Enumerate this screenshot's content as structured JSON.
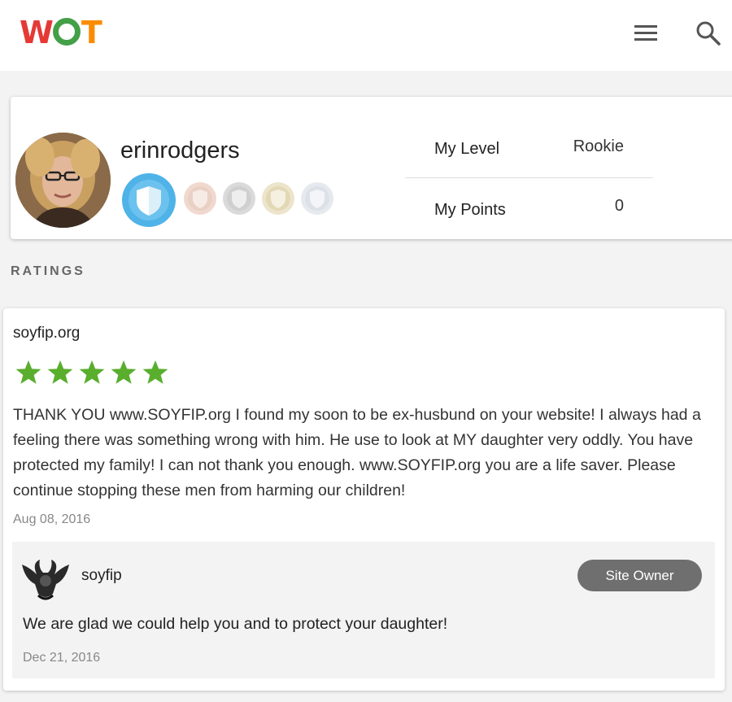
{
  "header": {
    "logo_text": "WOT",
    "menu_icon": "hamburger-menu-icon",
    "search_icon": "search-icon"
  },
  "profile": {
    "username": "erinrodgers",
    "avatar_icon": "user-photo-avatar",
    "badges": [
      {
        "name": "blue-shield-badge",
        "color": "#4fb3e8",
        "active": true
      },
      {
        "name": "rose-shield-badge",
        "color": "#e8c9bd",
        "active": false
      },
      {
        "name": "grey-shield-badge",
        "color": "#d0d0d0",
        "active": false
      },
      {
        "name": "gold-shield-badge",
        "color": "#e6dcbf",
        "active": false
      },
      {
        "name": "silver-shield-badge",
        "color": "#dde2e8",
        "active": false
      }
    ],
    "level_label": "My Level",
    "level_value": "Rookie",
    "points_label": "My Points",
    "points_value": "0"
  },
  "ratings": {
    "section_title": "RATINGS",
    "review": {
      "site": "soyfip.org",
      "stars": 5,
      "star_color": "#5aae2e",
      "text": "THANK YOU www.SOYFIP.org I found my soon to be ex-husbund on your website! I always had a feeling there was something wrong with him. He use to look at MY daughter very oddly. You have protected my family! I can not thank you enough. www.SOYFIP.org you are a life saver. Please continue stopping these men from harming our children!",
      "date": "Aug 08, 2016",
      "reply": {
        "user": "soyfip",
        "avatar_icon": "winged-emblem-avatar",
        "badge": "Site Owner",
        "text": "We are glad we could help you and to protect your daughter!",
        "date": "Dec 21, 2016"
      }
    }
  }
}
